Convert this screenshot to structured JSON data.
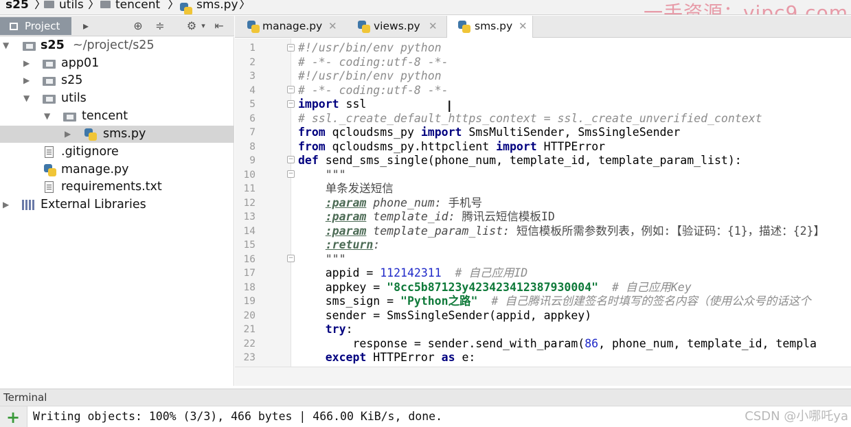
{
  "breadcrumb": [
    "s25",
    "utils",
    "tencent",
    "sms.py"
  ],
  "watermark_top": "一手资源：vipc9.com",
  "project_panel": {
    "tab_label": "Project",
    "tree": [
      {
        "label": "s25",
        "path": "~/project/s25",
        "type": "folder",
        "expanded": true,
        "level": 0
      },
      {
        "label": "app01",
        "type": "folder",
        "expanded": false,
        "level": 1
      },
      {
        "label": "s25",
        "type": "folder",
        "expanded": false,
        "level": 1
      },
      {
        "label": "utils",
        "type": "folder",
        "expanded": true,
        "level": 1
      },
      {
        "label": "tencent",
        "type": "folder",
        "expanded": true,
        "level": 2
      },
      {
        "label": "sms.py",
        "type": "python",
        "selected": true,
        "level": 3
      },
      {
        "label": ".gitignore",
        "type": "text",
        "level": 1
      },
      {
        "label": "manage.py",
        "type": "python",
        "level": 1
      },
      {
        "label": "requirements.txt",
        "type": "text",
        "level": 1
      },
      {
        "label": "External Libraries",
        "type": "library",
        "level": 0
      }
    ]
  },
  "editor_tabs": [
    {
      "label": "manage.py",
      "active": false
    },
    {
      "label": "views.py",
      "active": false
    },
    {
      "label": "sms.py",
      "active": true
    }
  ],
  "code": {
    "line_numbers": [
      "1",
      "2",
      "3",
      "4",
      "5",
      "6",
      "7",
      "8",
      "9",
      "10",
      "11",
      "12",
      "13",
      "14",
      "15",
      "16",
      "17",
      "18",
      "19",
      "20",
      "21",
      "22",
      "23"
    ],
    "lines": [
      [
        [
          "cm",
          "#!/usr/bin/env python"
        ]
      ],
      [
        [
          "cm",
          "# -*- coding:utf-8 -*-"
        ]
      ],
      [
        [
          "cm",
          "#!/usr/bin/env python"
        ]
      ],
      [
        [
          "cm",
          "# -*- coding:utf-8 -*-"
        ]
      ],
      [
        [
          "kw",
          "import"
        ],
        [
          "p",
          " ssl"
        ]
      ],
      [
        [
          "cm",
          "# ssl._create_default_https_context = ssl._create_unverified_context"
        ]
      ],
      [
        [
          "kw",
          "from"
        ],
        [
          "p",
          " qcloudsms_py "
        ],
        [
          "kw",
          "import"
        ],
        [
          "p",
          " SmsMultiSender, SmsSingleSender"
        ]
      ],
      [
        [
          "kw",
          "from"
        ],
        [
          "p",
          " qcloudsms_py.httpclient "
        ],
        [
          "kw",
          "import"
        ],
        [
          "p",
          " HTTPError"
        ]
      ],
      [
        [
          "kw",
          "def"
        ],
        [
          "p",
          " send_sms_single(phone_num, template_id, template_param_list):"
        ]
      ],
      [
        [
          "dcm",
          "    \"\"\""
        ]
      ],
      [
        [
          "dcm",
          "    单条发送短信"
        ]
      ],
      [
        [
          "p",
          "    "
        ],
        [
          "dtag",
          ":param"
        ],
        [
          "dname",
          " phone_num:"
        ],
        [
          "dcm",
          " 手机号"
        ]
      ],
      [
        [
          "p",
          "    "
        ],
        [
          "dtag",
          ":param"
        ],
        [
          "dname",
          " template_id:"
        ],
        [
          "dcm",
          " 腾讯云短信模板ID"
        ]
      ],
      [
        [
          "p",
          "    "
        ],
        [
          "dtag",
          ":param"
        ],
        [
          "dname",
          " template_param_list:"
        ],
        [
          "dcm",
          " 短信模板所需参数列表，例如:【验证码：{1}，描述：{2}】"
        ]
      ],
      [
        [
          "p",
          "    "
        ],
        [
          "dtag",
          ":return"
        ],
        [
          "dname",
          ":"
        ]
      ],
      [
        [
          "dcm",
          "    \"\"\""
        ]
      ],
      [
        [
          "p",
          "    appid = "
        ],
        [
          "num",
          "112142311"
        ],
        [
          "cm",
          "  # 自己应用ID"
        ]
      ],
      [
        [
          "p",
          "    appkey = "
        ],
        [
          "str",
          "\"8cc5b87123y423423412387930004\""
        ],
        [
          "cm",
          "  # 自己应用Key"
        ]
      ],
      [
        [
          "p",
          "    sms_sign = "
        ],
        [
          "str",
          "\"Python之路\""
        ],
        [
          "cm",
          "  # 自己腾讯云创建签名时填写的签名内容（使用公众号的话这个"
        ]
      ],
      [
        [
          "p",
          "    sender = SmsSingleSender(appid, appkey)"
        ]
      ],
      [
        [
          "p",
          "    "
        ],
        [
          "kw",
          "try"
        ],
        [
          "p",
          ":"
        ]
      ],
      [
        [
          "p",
          "        response = sender.send_with_param("
        ],
        [
          "num",
          "86"
        ],
        [
          "p",
          ", phone_num, template_id, templa"
        ]
      ],
      [
        [
          "p",
          "    "
        ],
        [
          "kw",
          "except"
        ],
        [
          "p",
          " HTTPError "
        ],
        [
          "kw",
          "as"
        ],
        [
          "p",
          " e:"
        ]
      ]
    ]
  },
  "terminal": {
    "title": "Terminal",
    "output": "Writing objects: 100% (3/3), 466 bytes | 466.00 KiB/s, done."
  },
  "watermark_bottom": "CSDN @小哪吒ya"
}
